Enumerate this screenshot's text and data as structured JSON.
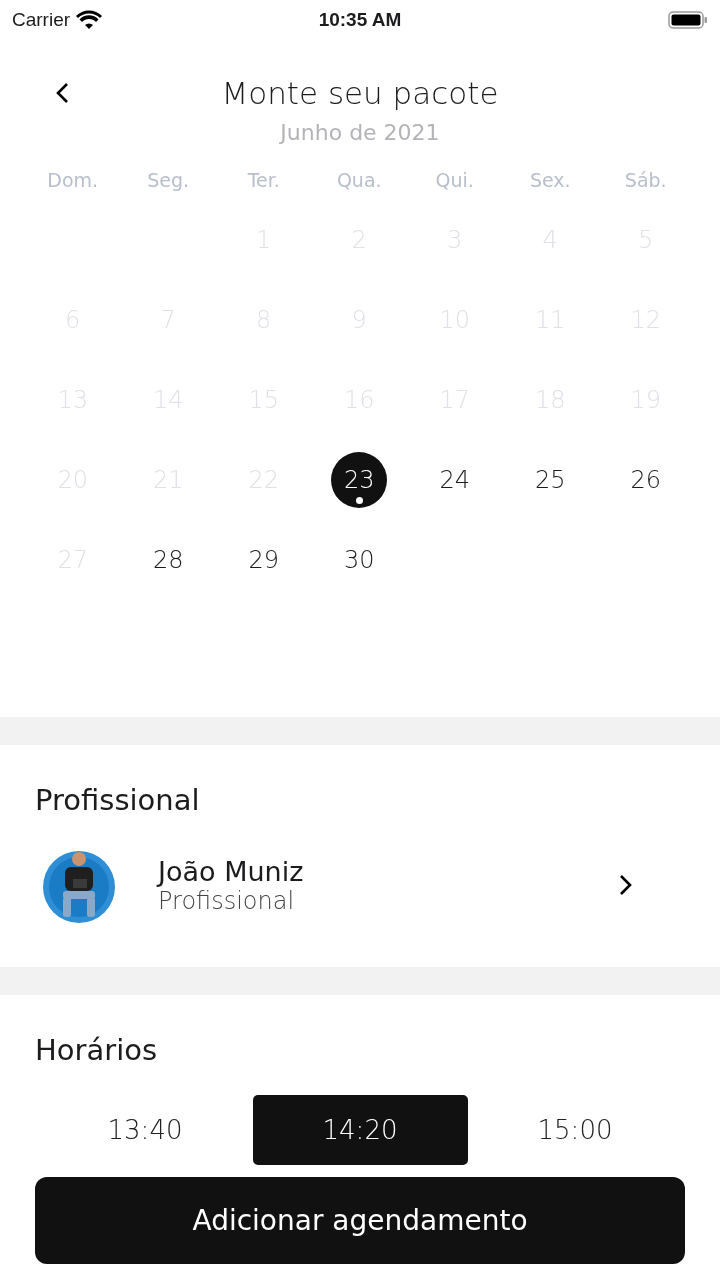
{
  "status_bar": {
    "carrier": "Carrier",
    "time": "10:35 AM"
  },
  "header": {
    "title": "Monte seu pacote"
  },
  "calendar": {
    "month": "Junho de 2021",
    "weekdays": [
      "Dom.",
      "Seg.",
      "Ter.",
      "Qua.",
      "Qui.",
      "Sex.",
      "Sáb."
    ],
    "weeks": [
      [
        {
          "kind": "blank"
        },
        {
          "kind": "blank"
        },
        {
          "kind": "day",
          "label": "1",
          "disabled": true,
          "selected": false,
          "today": false
        },
        {
          "kind": "day",
          "label": "2",
          "disabled": true,
          "selected": false,
          "today": false
        },
        {
          "kind": "day",
          "label": "3",
          "disabled": true,
          "selected": false,
          "today": false
        },
        {
          "kind": "day",
          "label": "4",
          "disabled": true,
          "selected": false,
          "today": false
        },
        {
          "kind": "day",
          "label": "5",
          "disabled": true,
          "selected": false,
          "today": false
        }
      ],
      [
        {
          "kind": "day",
          "label": "6",
          "disabled": true,
          "selected": false,
          "today": false
        },
        {
          "kind": "day",
          "label": "7",
          "disabled": true,
          "selected": false,
          "today": false
        },
        {
          "kind": "day",
          "label": "8",
          "disabled": true,
          "selected": false,
          "today": false
        },
        {
          "kind": "day",
          "label": "9",
          "disabled": true,
          "selected": false,
          "today": false
        },
        {
          "kind": "day",
          "label": "10",
          "disabled": true,
          "selected": false,
          "today": false
        },
        {
          "kind": "day",
          "label": "11",
          "disabled": true,
          "selected": false,
          "today": false
        },
        {
          "kind": "day",
          "label": "12",
          "disabled": true,
          "selected": false,
          "today": false
        }
      ],
      [
        {
          "kind": "day",
          "label": "13",
          "disabled": true,
          "selected": false,
          "today": false
        },
        {
          "kind": "day",
          "label": "14",
          "disabled": true,
          "selected": false,
          "today": false
        },
        {
          "kind": "day",
          "label": "15",
          "disabled": true,
          "selected": false,
          "today": false
        },
        {
          "kind": "day",
          "label": "16",
          "disabled": true,
          "selected": false,
          "today": false
        },
        {
          "kind": "day",
          "label": "17",
          "disabled": true,
          "selected": false,
          "today": false
        },
        {
          "kind": "day",
          "label": "18",
          "disabled": true,
          "selected": false,
          "today": false
        },
        {
          "kind": "day",
          "label": "19",
          "disabled": true,
          "selected": false,
          "today": false
        }
      ],
      [
        {
          "kind": "day",
          "label": "20",
          "disabled": true,
          "selected": false,
          "today": false
        },
        {
          "kind": "day",
          "label": "21",
          "disabled": true,
          "selected": false,
          "today": false
        },
        {
          "kind": "day",
          "label": "22",
          "disabled": true,
          "selected": false,
          "today": false
        },
        {
          "kind": "day",
          "label": "23",
          "disabled": false,
          "selected": true,
          "today": true
        },
        {
          "kind": "day",
          "label": "24",
          "disabled": false,
          "selected": false,
          "today": false
        },
        {
          "kind": "day",
          "label": "25",
          "disabled": false,
          "selected": false,
          "today": false
        },
        {
          "kind": "day",
          "label": "26",
          "disabled": false,
          "selected": false,
          "today": false
        }
      ],
      [
        {
          "kind": "day",
          "label": "27",
          "disabled": true,
          "selected": false,
          "today": false
        },
        {
          "kind": "day",
          "label": "28",
          "disabled": false,
          "selected": false,
          "today": false
        },
        {
          "kind": "day",
          "label": "29",
          "disabled": false,
          "selected": false,
          "today": false
        },
        {
          "kind": "day",
          "label": "30",
          "disabled": false,
          "selected": false,
          "today": false
        }
      ]
    ]
  },
  "professional": {
    "heading": "Profissional",
    "name": "João Muniz",
    "role": "Profissional"
  },
  "schedule": {
    "heading": "Horários",
    "times": [
      {
        "label": "13:40",
        "selected": false
      },
      {
        "label": "14:20",
        "selected": true
      },
      {
        "label": "15:00",
        "selected": false
      }
    ]
  },
  "action_button": "Adicionar agendamento"
}
